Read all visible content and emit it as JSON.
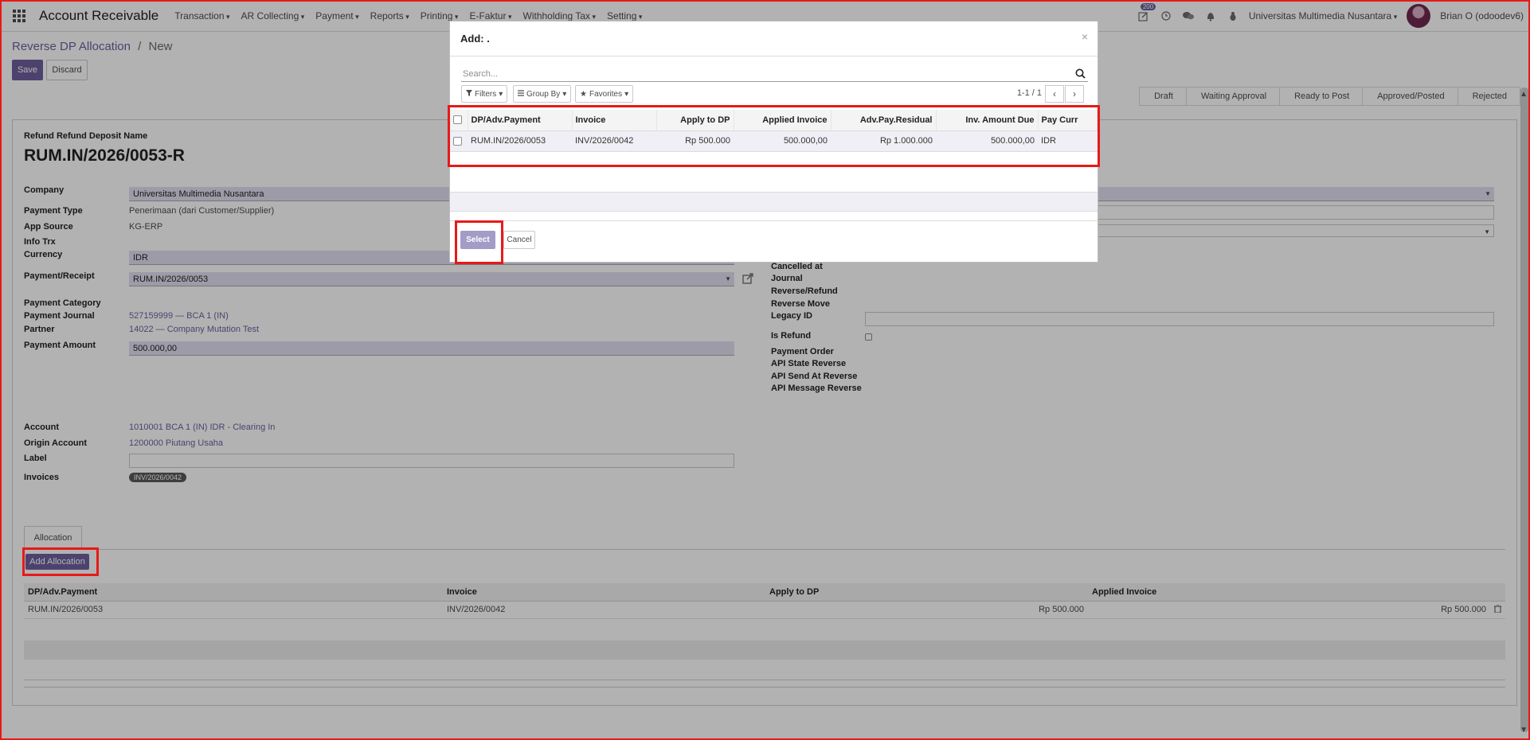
{
  "navbar": {
    "app_title": "Account Receivable",
    "menu": [
      "Transaction",
      "AR Collecting",
      "Payment",
      "Reports",
      "Printing",
      "E-Faktur",
      "Withholding Tax",
      "Setting"
    ],
    "badge": "200",
    "company": "Universitas Multimedia Nusantara",
    "user": "Brian O (odoodev6)"
  },
  "breadcrumb": {
    "parent": "Reverse DP Allocation",
    "separator": "/",
    "current": "New"
  },
  "buttons": {
    "save": "Save",
    "discard": "Discard",
    "add_allocation": "Add Allocation"
  },
  "status_steps": [
    "Draft",
    "Waiting Approval",
    "Ready to Post",
    "Approved/Posted",
    "Rejected"
  ],
  "form": {
    "title_label": "Refund Refund Deposit Name",
    "title_value": "RUM.IN/2026/0053-R",
    "company_label": "Company",
    "company_value": "Universitas Multimedia Nusantara",
    "payment_type_label": "Payment Type",
    "payment_type_value": "Penerimaan (dari Customer/Supplier)",
    "app_source_label": "App Source",
    "app_source_value": "KG-ERP",
    "info_trx_label": "Info Trx",
    "currency_label": "Currency",
    "currency_value": "IDR",
    "payment_receipt_label": "Payment/Receipt",
    "payment_receipt_value": "RUM.IN/2026/0053",
    "payment_category_label": "Payment Category",
    "payment_journal_label": "Payment Journal",
    "payment_journal_value": "527159999 — BCA 1 (IN)",
    "partner_label": "Partner",
    "partner_value": "14022 — Company Mutation Test",
    "payment_amount_label": "Payment Amount",
    "payment_amount_value": "500.000,00",
    "account_label": "Account",
    "account_value": "1010001 BCA 1 (IN) IDR - Clearing In",
    "origin_account_label": "Origin Account",
    "origin_account_value": "1200000 Piutang Usaha",
    "label_label": "Label",
    "invoices_label": "Invoices",
    "invoices_tag": "INV/2026/0042",
    "right_labels": {
      "cancelled_at": "Cancelled at",
      "journal": "Journal",
      "reverse_refund": "Reverse/Refund",
      "reverse_move": "Reverse Move",
      "legacy_id": "Legacy ID",
      "is_refund": "Is Refund",
      "payment_order": "Payment Order",
      "api_state_reverse": "API State Reverse",
      "api_send_at_reverse": "API Send At Reverse",
      "api_message_reverse": "API Message Reverse"
    }
  },
  "allocation": {
    "tab_label": "Allocation",
    "headers": [
      "DP/Adv.Payment",
      "Invoice",
      "Apply to DP",
      "Applied Invoice"
    ],
    "rows": [
      [
        "RUM.IN/2026/0053",
        "INV/2026/0042",
        "Rp 500.000",
        "Rp 500.000"
      ]
    ]
  },
  "modal": {
    "title": "Add: .",
    "close": "×",
    "search_placeholder": "Search...",
    "filters": "Filters",
    "group_by": "Group By",
    "favorites": "Favorites",
    "pager": "1-1 / 1",
    "headers": [
      "DP/Adv.Payment",
      "Invoice",
      "Apply to DP",
      "Applied Invoice",
      "Adv.Pay.Residual",
      "Inv. Amount Due",
      "Pay Curr"
    ],
    "rows": [
      [
        "RUM.IN/2026/0053",
        "INV/2026/0042",
        "Rp 500.000",
        "500.000,00",
        "Rp 1.000.000",
        "500.000,00",
        "IDR"
      ]
    ],
    "select": "Select",
    "cancel": "Cancel"
  },
  "colors": {
    "primary": "#6f5f9e",
    "highlight": "#e81919",
    "field_bg": "#e2def2"
  }
}
